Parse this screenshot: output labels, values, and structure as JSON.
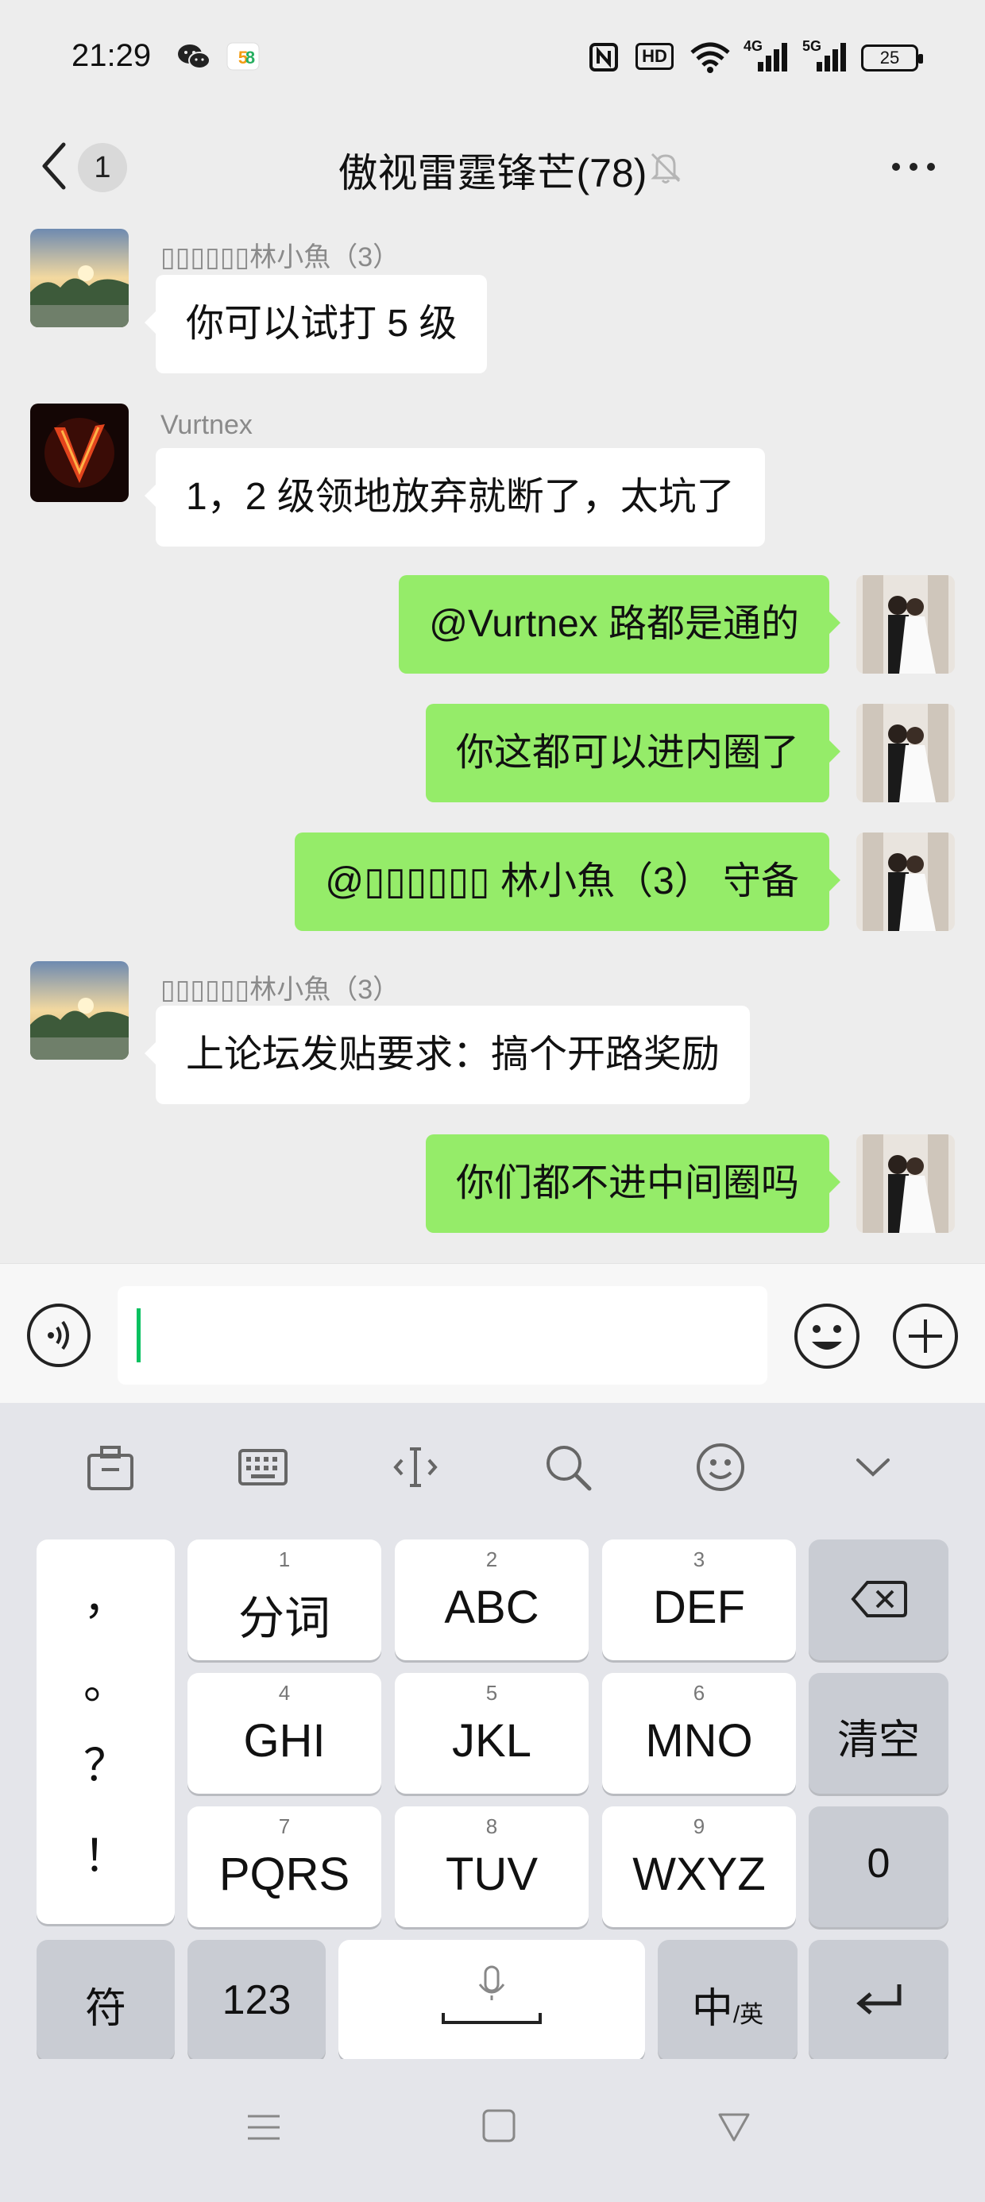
{
  "status_bar": {
    "time": "21:29",
    "battery": "25",
    "network_4g": "4G",
    "network_5g": "5G",
    "hd_label": "HD"
  },
  "header": {
    "back_count": "1",
    "title": "傲视雷霆锋芒(78)"
  },
  "messages": [
    {
      "direction": "in",
      "sender": "▯▯▯▯▯▯林小魚（3）",
      "text": "你可以试打 5 级"
    },
    {
      "direction": "in",
      "sender": "Vurtnex",
      "text": "1，2 级领地放弃就断了，太坑了"
    },
    {
      "direction": "out",
      "text": "@Vurtnex  路都是通的"
    },
    {
      "direction": "out",
      "text": "你这都可以进内圈了"
    },
    {
      "direction": "out",
      "text": "@▯▯▯▯▯▯ 林小魚（3）  守备"
    },
    {
      "direction": "in",
      "sender": "▯▯▯▯▯▯林小魚（3）",
      "text": "上论坛发贴要求：搞个开路奖励"
    },
    {
      "direction": "out",
      "text": "你们都不进中间圈吗"
    }
  ],
  "keyboard": {
    "punct": [
      "，",
      "。",
      "？",
      "！"
    ],
    "keys": [
      {
        "num": "1",
        "label": "分词"
      },
      {
        "num": "2",
        "label": "ABC"
      },
      {
        "num": "3",
        "label": "DEF"
      },
      {
        "num": "4",
        "label": "GHI"
      },
      {
        "num": "5",
        "label": "JKL"
      },
      {
        "num": "6",
        "label": "MNO"
      },
      {
        "num": "7",
        "label": "PQRS"
      },
      {
        "num": "8",
        "label": "TUV"
      },
      {
        "num": "9",
        "label": "WXYZ"
      }
    ],
    "clear": "清空",
    "zero": "0",
    "symbols": "符",
    "numbers": "123",
    "lang_main": "中",
    "lang_sub": "/英"
  },
  "colors": {
    "outgoing_bubble": "#95ec69",
    "incoming_bubble": "#ffffff",
    "chat_background": "#ededed",
    "cursor": "#07c160"
  }
}
